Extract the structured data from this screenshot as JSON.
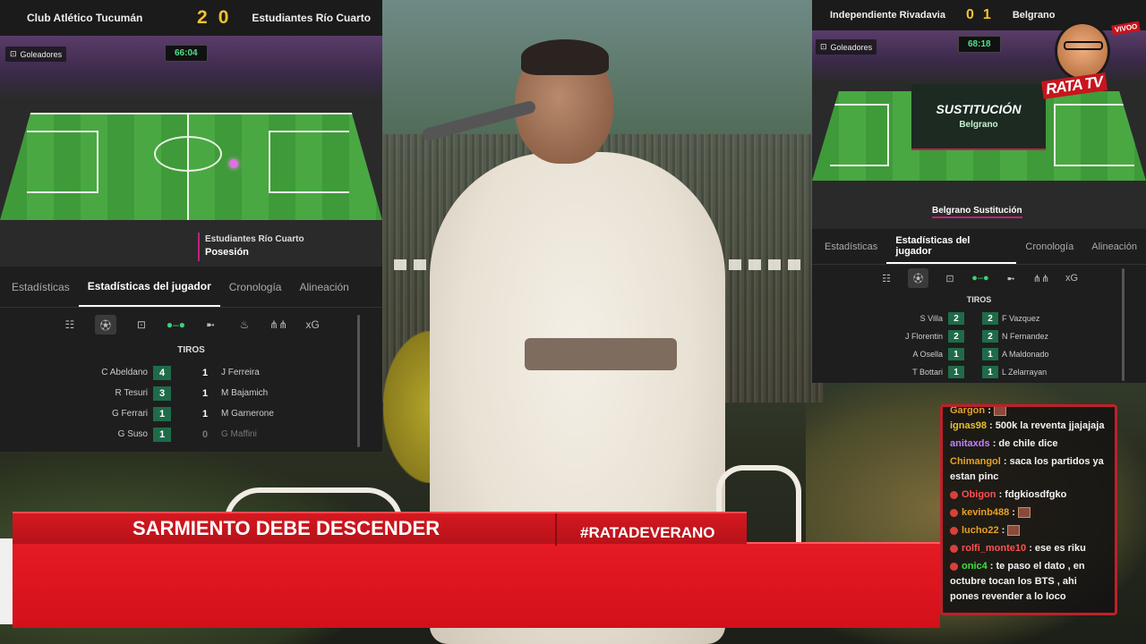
{
  "widget_left": {
    "home_team": "Club Atlético Tucumán",
    "away_team": "Estudiantes Río Cuarto",
    "home_score": "2",
    "away_score": "0",
    "scorers_label": "Goleadores",
    "clock": "66:04",
    "event_team": "Estudiantes Río Cuarto",
    "event_label": "Posesión",
    "tabs": [
      "Estadísticas",
      "Estadísticas del jugador",
      "Cronología",
      "Alineación"
    ],
    "active_tab": "Estadísticas del jugador",
    "stat_icons": [
      "list-icon",
      "shot-icon",
      "goal-icon",
      "pass-icon",
      "tackle-icon",
      "foul-icon",
      "lineup-icon"
    ],
    "xg_label": "xG",
    "section_title": "TIROS",
    "rows": [
      {
        "left_name": "C Abeldano",
        "left_val": "4",
        "right_val": "1",
        "right_name": "J Ferreira"
      },
      {
        "left_name": "R Tesuri",
        "left_val": "3",
        "right_val": "1",
        "right_name": "M Bajamich"
      },
      {
        "left_name": "G Ferrari",
        "left_val": "1",
        "right_val": "1",
        "right_name": "M Garnerone"
      },
      {
        "left_name": "G Suso",
        "left_val": "1",
        "right_val": "0",
        "right_name": "G Maffini"
      }
    ]
  },
  "widget_right": {
    "home_team": "Independiente Rivadavia",
    "away_team": "Belgrano",
    "home_score": "0",
    "away_score": "1",
    "scorers_label": "Goleadores",
    "clock": "68:18",
    "overlay_title": "SUSTITUCIÓN",
    "overlay_team": "Belgrano",
    "event_team": "Belgrano",
    "event_label": "Sustitución",
    "tabs": [
      "Estadísticas",
      "Estadísticas del jugador",
      "Cronología",
      "Alineación"
    ],
    "active_tab": "Estadísticas del jugador",
    "xg_label": "xG",
    "section_title": "TIROS",
    "rows": [
      {
        "left_name": "S Villa",
        "left_val": "2",
        "right_val": "2",
        "right_name": "F Vazquez"
      },
      {
        "left_name": "J Florentin",
        "left_val": "2",
        "right_val": "2",
        "right_name": "N Fernandez"
      },
      {
        "left_name": "A Osella",
        "left_val": "1",
        "right_val": "1",
        "right_name": "A Maldonado"
      },
      {
        "left_name": "T Bottari",
        "left_val": "1",
        "right_val": "1",
        "right_name": "L Zelarrayan"
      }
    ]
  },
  "banner": {
    "headline": "SARMIENTO DEBE DESCENDER",
    "hashtag": "#RATADEVERANO"
  },
  "logo": {
    "text": "RATA TV",
    "live": "VIVOO"
  },
  "chat": {
    "messages": [
      {
        "user": "Gargon",
        "user_color": "#e0a030",
        "text": ":",
        "emote": true,
        "badge": false
      },
      {
        "user": "ignas98",
        "user_color": "#e8c030",
        "text": ": 500k la reventa jjajajaja",
        "emote": false,
        "badge": false
      },
      {
        "user": "anitaxds",
        "user_color": "#c080ff",
        "text": ": de chile dice",
        "emote": false,
        "badge": false
      },
      {
        "user": "Chimangol",
        "user_color": "#e8a020",
        "text": ": saca los partidos ya estan pinc",
        "emote": false,
        "badge": false
      },
      {
        "user": "Obigon",
        "user_color": "#ff5050",
        "text": ": fdgkiosdfgko",
        "emote": false,
        "badge": true
      },
      {
        "user": "kevinb488",
        "user_color": "#e8a020",
        "text": ":",
        "emote": true,
        "badge": true
      },
      {
        "user": "lucho22",
        "user_color": "#e8a020",
        "text": ":",
        "emote": true,
        "badge": true
      },
      {
        "user": "rolfi_monte10",
        "user_color": "#ff5050",
        "text": ": ese es riku",
        "emote": false,
        "badge": true
      },
      {
        "user": "onic4",
        "user_color": "#40e040",
        "text": ": te paso el dato , en octubre tocan los BTS , ahi pones revender a lo loco",
        "emote": false,
        "badge": true
      }
    ]
  },
  "colors": {
    "banner_red": "#d3101a",
    "score_yellow": "#f2c230",
    "clock_green": "#4fe08a",
    "stat_green": "#1f6b49",
    "chat_border": "#c0202a"
  }
}
